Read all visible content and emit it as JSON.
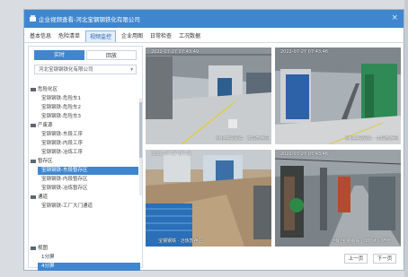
{
  "window": {
    "title": "企业视频查看-河北宝钢钢铁化有限公司",
    "close": "×"
  },
  "tabs": [
    {
      "label": "基本信息"
    },
    {
      "label": "危险清单"
    },
    {
      "label": "视频监控"
    },
    {
      "label": "企业用图"
    },
    {
      "label": "日常检查"
    },
    {
      "label": "工况数据"
    }
  ],
  "left": {
    "subtabs": [
      {
        "label": "实时"
      },
      {
        "label": "回放"
      }
    ],
    "company": "河北宝钢钢铁化有限公司",
    "tree": [
      {
        "type": "group",
        "label": "危险化区"
      },
      {
        "type": "leaf",
        "label": "宝钢钢铁-危险车1"
      },
      {
        "type": "leaf",
        "label": "宝钢钢铁-危险车2"
      },
      {
        "type": "leaf",
        "label": "宝钢钢铁-危险车3"
      },
      {
        "type": "group",
        "label": "产废源"
      },
      {
        "type": "leaf",
        "label": "宝钢钢铁-东段工序"
      },
      {
        "type": "leaf",
        "label": "宝钢钢铁-内段工序"
      },
      {
        "type": "leaf",
        "label": "宝钢钢铁-冶炼工序"
      },
      {
        "type": "group",
        "label": "暂存区"
      },
      {
        "type": "sel",
        "label": "宝钢钢铁-东段暂存区"
      },
      {
        "type": "leaf",
        "label": "宝钢钢铁-内段暂存区"
      },
      {
        "type": "leaf",
        "label": "宝钢钢铁-冶炼暂存区"
      },
      {
        "type": "group",
        "label": "通道"
      },
      {
        "type": "leaf",
        "label": "宝钢钢铁-工厂大门通道"
      }
    ],
    "view": {
      "heading": "视图",
      "options": [
        {
          "label": "1分屏"
        },
        {
          "label": "4分屏"
        }
      ],
      "selected": "4分屏"
    }
  },
  "cameras": [
    {
      "timestamp": "2022-07-27 07:43:49",
      "label": "河北宝钢钢铁 · 东段暂存区"
    },
    {
      "timestamp": "2022-07-27 07:43:46",
      "label": "河北宝钢钢铁 · 内段暂存区"
    },
    {
      "timestamp": "2022-07-27 07:43",
      "label": "宝钢钢铁 · 冶炼暂存区"
    },
    {
      "timestamp": "2022-07-27 07:43:46",
      "label": "河北宝钢钢铁 · 工厂大门通道"
    }
  ],
  "pager": {
    "prev": "上一页",
    "next": "下一页"
  },
  "colors": {
    "accent": "#3f86cf",
    "titlebar": "#3f86cf"
  }
}
